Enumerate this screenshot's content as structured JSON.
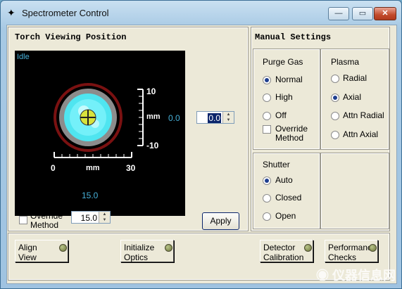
{
  "window": {
    "title": "Spectrometer Control"
  },
  "torch": {
    "heading": "Torch Viewing Position",
    "status": "Idle",
    "y_top": "10",
    "y_bottom": "-10",
    "y_unit": "mm",
    "y_value": "0.0",
    "x_min": "0",
    "x_unit": "mm",
    "x_max": "30",
    "x_value": "15.0",
    "y_spin_value": "0.0",
    "override_label": "Override Method",
    "x_spin_value": "15.0",
    "apply_label": "Apply"
  },
  "manual": {
    "heading": "Manual Settings",
    "purge_gas": {
      "title": "Purge Gas",
      "options": [
        "Normal",
        "High",
        "Off"
      ],
      "selected": "Normal",
      "override_label": "Override Method"
    },
    "plasma": {
      "title": "Plasma",
      "options": [
        "Radial",
        "Axial",
        "Attn Radial",
        "Attn Axial"
      ],
      "selected": "Axial"
    },
    "shutter": {
      "title": "Shutter",
      "options": [
        "Auto",
        "Closed",
        "Open"
      ],
      "selected": "Auto"
    }
  },
  "bottom_buttons": [
    {
      "label": "Align View"
    },
    {
      "label": "Initialize Optics"
    },
    {
      "label": "Detector Calibration"
    },
    {
      "label": "Performance Checks"
    }
  ],
  "watermark": "仪器信息网"
}
